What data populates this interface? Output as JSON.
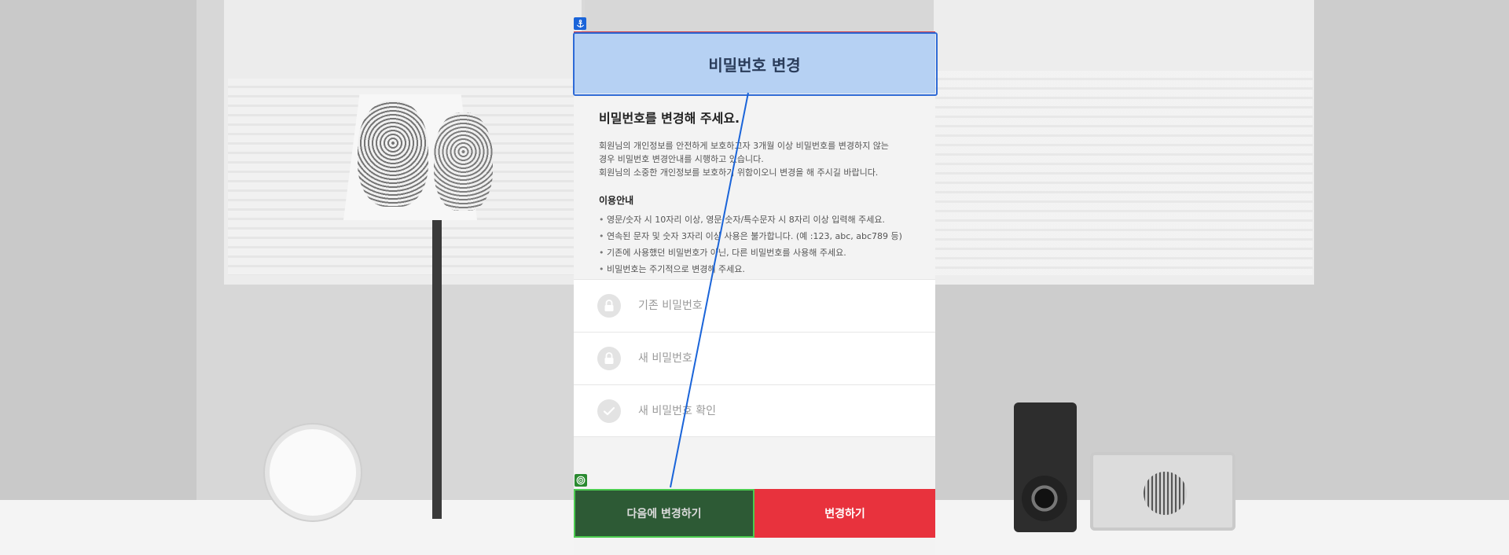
{
  "modal": {
    "title": "비밀번호 변경",
    "heading": "비밀번호를 변경해 주세요.",
    "description": [
      "회원님의 개인정보를 안전하게 보호하고자 3개월 이상 비밀번호를 변경하지 않는",
      "경우 비밀번호 변경안내를 시행하고 있습니다.",
      "회원님의 소중한 개인정보를 보호하기 위함이오니 변경을 해 주시길 바랍니다."
    ],
    "guide_title": "이용안내",
    "guide_items": [
      "영문/숫자 시 10자리 이상, 영문/숫자/특수문자 시 8자리 이상 입력해 주세요.",
      "연속된 문자 및 숫자 3자리 이상 사용은 불가합니다. (예 :123, abc, abc789 등)",
      "기존에 사용했던 비밀번호가 아닌, 다른 비밀번호를 사용해 주세요.",
      "비밀번호는 주기적으로 변경해 주세요."
    ],
    "fields": {
      "current_password": {
        "placeholder": "기존 비밀번호",
        "value": "",
        "icon": "lock-icon"
      },
      "new_password": {
        "placeholder": "새 비밀번호",
        "value": "",
        "icon": "lock-icon"
      },
      "confirm_password": {
        "placeholder": "새 비밀번호 확인",
        "value": "",
        "icon": "check-icon"
      }
    },
    "buttons": {
      "later_label": "다음에 변경하기",
      "change_label": "변경하기"
    }
  },
  "colors": {
    "header_bg": "#b6d1f3",
    "header_top_border": "#d03a44",
    "change_button": "#e8323d",
    "later_button": "#2d5a35",
    "selection_outline": "#2e6ad6",
    "target_outline": "#4bcb4f"
  },
  "overlay_icons": {
    "anchor": "anchor-icon",
    "target": "target-icon"
  }
}
